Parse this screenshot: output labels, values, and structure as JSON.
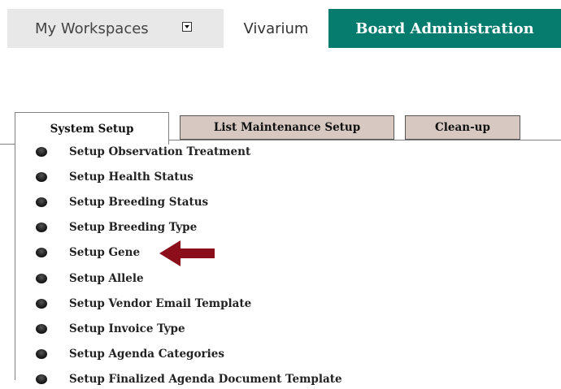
{
  "topnav": {
    "workspaces_label": "My Workspaces",
    "vivarium_label": "Vivarium",
    "board_admin_label": "Board Administration",
    "accent_color": "#067c6e"
  },
  "tabs": [
    {
      "label": "System Setup",
      "active": true
    },
    {
      "label": "List Maintenance Setup",
      "active": false
    },
    {
      "label": "Clean-up",
      "active": false
    }
  ],
  "setup_items": [
    "Setup Observation Treatment",
    "Setup Health Status",
    "Setup Breeding Status",
    "Setup Breeding Type",
    "Setup Gene",
    "Setup Allele",
    "Setup Vendor Email Template",
    "Setup Invoice Type",
    "Setup Agenda Categories",
    "Setup Finalized Agenda Document Template"
  ],
  "annotation": {
    "arrow_color": "#8b0e1a",
    "points_to": "Setup Gene",
    "icon": "left-arrow-icon"
  }
}
